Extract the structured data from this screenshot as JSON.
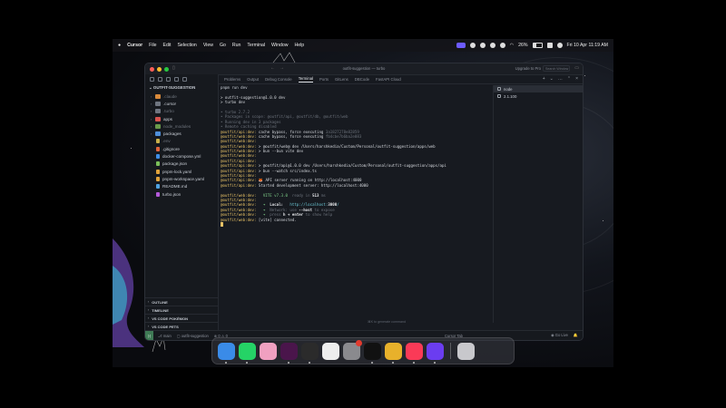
{
  "menubar": {
    "app": "Cursor",
    "menus": [
      "File",
      "Edit",
      "Selection",
      "View",
      "Go",
      "Run",
      "Terminal",
      "Window",
      "Help"
    ],
    "battery": "26%",
    "datetime": "Fri 10 Apr  11:19 AM"
  },
  "window": {
    "title": "outfit-suggestion — turbo",
    "upgrade": "Upgrade to Pro",
    "search_placeholder": "Search Window"
  },
  "sidebar": {
    "header": "OUTFIT-SUGGESTION",
    "items": [
      {
        "label": ".claude",
        "type": "folder",
        "color": "#d98a3b",
        "dim": true
      },
      {
        "label": ".cursor",
        "type": "folder",
        "color": "#6f7580",
        "dim": false
      },
      {
        "label": ".turbo",
        "type": "folder",
        "color": "#6f7580",
        "dim": true
      },
      {
        "label": "apps",
        "type": "folder",
        "color": "#d9534f",
        "dim": false
      },
      {
        "label": "node_modules",
        "type": "folder",
        "color": "#6a9a4a",
        "dim": true
      },
      {
        "label": "packages",
        "type": "folder",
        "color": "#4f8fd9",
        "dim": false
      },
      {
        "label": ".env",
        "type": "file",
        "color": "#c9b04a",
        "dim": true
      },
      {
        "label": ".gitignore",
        "type": "file",
        "color": "#e0633a",
        "dim": false
      },
      {
        "label": "docker-compose.yml",
        "type": "file",
        "color": "#3e8ee6",
        "dim": false
      },
      {
        "label": "package.json",
        "type": "file",
        "color": "#7bbf5a",
        "dim": false
      },
      {
        "label": "pnpm-lock.yaml",
        "type": "file",
        "color": "#e0a23a",
        "dim": false
      },
      {
        "label": "pnpm-workspace.yaml",
        "type": "file",
        "color": "#e0a23a",
        "dim": false
      },
      {
        "label": "README.md",
        "type": "file",
        "color": "#4fa3e0",
        "dim": false
      },
      {
        "label": "turbo.json",
        "type": "file",
        "color": "#b35ad9",
        "dim": false
      }
    ],
    "panels": [
      "OUTLINE",
      "TIMELINE",
      "VS CODE POKÉMON",
      "VS CODE PETS"
    ]
  },
  "panel_tabs": [
    {
      "label": "Problems",
      "active": false
    },
    {
      "label": "Output",
      "active": false
    },
    {
      "label": "Debug Console",
      "active": false
    },
    {
      "label": "Terminal",
      "active": true
    },
    {
      "label": "Ports",
      "active": false
    },
    {
      "label": "GitLens",
      "active": false
    },
    {
      "label": "DBCode",
      "active": false
    },
    {
      "label": "FastAPI Cloud",
      "active": false
    }
  ],
  "terminal_lines": [
    [
      {
        "t": "pnpm run dev",
        "c": "c-prompt"
      }
    ],
    [],
    [
      {
        "t": "> outfit-suggestion@1.0.0 dev",
        "c": ""
      }
    ],
    [
      {
        "t": "> turbo dev",
        "c": ""
      }
    ],
    [],
    [
      {
        "t": "• turbo 2.7.2",
        "c": "c-dim"
      }
    ],
    [
      {
        "t": "• Packages in scope: @outfit/api, @outfit/db, @outfit/web",
        "c": "c-dim"
      }
    ],
    [
      {
        "t": "• Running dev in 3 packages",
        "c": "c-dim"
      }
    ],
    [
      {
        "t": "• Remote caching disabled",
        "c": "c-dim"
      }
    ],
    [
      {
        "t": "@outfit/api:dev: ",
        "c": "c-y"
      },
      {
        "t": "cache bypass, force executing ",
        "c": ""
      },
      {
        "t": "3a1827278e82859",
        "c": "c-dim"
      }
    ],
    [
      {
        "t": "@outfit/web:dev: ",
        "c": "c-y"
      },
      {
        "t": "cache bypass, force executing ",
        "c": ""
      },
      {
        "t": "fb4cbe7b6ba2e083",
        "c": "c-dim"
      }
    ],
    [
      {
        "t": "@outfit/web:dev: ",
        "c": "c-y"
      }
    ],
    [
      {
        "t": "@outfit/web:dev: ",
        "c": "c-y"
      },
      {
        "t": "> @outfit/web@ dev /Users/harshkedia/Custom/Personal/outfit-suggestion/apps/web",
        "c": ""
      }
    ],
    [
      {
        "t": "@outfit/web:dev: ",
        "c": "c-y"
      },
      {
        "t": "> bun --bun vite dev",
        "c": ""
      }
    ],
    [
      {
        "t": "@outfit/web:dev: ",
        "c": "c-y"
      }
    ],
    [
      {
        "t": "@outfit/api:dev: ",
        "c": "c-y"
      }
    ],
    [
      {
        "t": "@outfit/api:dev: ",
        "c": "c-y"
      },
      {
        "t": "> @outfit/api@1.0.0 dev /Users/harshkedia/Custom/Personal/outfit-suggestion/apps/api",
        "c": ""
      }
    ],
    [
      {
        "t": "@outfit/api:dev: ",
        "c": "c-y"
      },
      {
        "t": "> bun --watch src/index.ts",
        "c": ""
      }
    ],
    [
      {
        "t": "@outfit/api:dev: ",
        "c": "c-y"
      }
    ],
    [
      {
        "t": "@outfit/api:dev: ",
        "c": "c-y"
      },
      {
        "t": "🦊 API server running on http://localhost:4000",
        "c": ""
      }
    ],
    [
      {
        "t": "@outfit/api:dev: ",
        "c": "c-y"
      },
      {
        "t": "Started development server: http://localhost:4000",
        "c": ""
      }
    ],
    [],
    [
      {
        "t": "@outfit/web:dev: ",
        "c": "c-y"
      },
      {
        "t": "  VITE ",
        "c": "c-g"
      },
      {
        "t": "v7.3.0  ",
        "c": "c-g"
      },
      {
        "t": "ready in ",
        "c": "c-dim"
      },
      {
        "t": "513",
        "c": "c-b"
      },
      {
        "t": " ms",
        "c": "c-dim"
      }
    ],
    [
      {
        "t": "@outfit/web:dev: ",
        "c": "c-y"
      }
    ],
    [
      {
        "t": "@outfit/web:dev: ",
        "c": "c-y"
      },
      {
        "t": "  ➜  ",
        "c": "c-g"
      },
      {
        "t": "Local:   ",
        "c": "c-b"
      },
      {
        "t": "http://localhost:",
        "c": "c-c"
      },
      {
        "t": "3000",
        "c": "c-b"
      },
      {
        "t": "/",
        "c": "c-c"
      }
    ],
    [
      {
        "t": "@outfit/web:dev: ",
        "c": "c-y"
      },
      {
        "t": "  ➜  ",
        "c": "c-g"
      },
      {
        "t": "Network: use ",
        "c": "c-dim"
      },
      {
        "t": "--host",
        "c": "c-b"
      },
      {
        "t": " to expose",
        "c": "c-dim"
      }
    ],
    [
      {
        "t": "@outfit/web:dev: ",
        "c": "c-y"
      },
      {
        "t": "  ➜  ",
        "c": "c-g"
      },
      {
        "t": "press ",
        "c": "c-dim"
      },
      {
        "t": "h + enter",
        "c": "c-b"
      },
      {
        "t": " to show help",
        "c": "c-dim"
      }
    ],
    [
      {
        "t": "@outfit/web:dev: ",
        "c": "c-y"
      },
      {
        "t": "[vite] connected.",
        "c": ""
      }
    ]
  ],
  "terminal_list": [
    {
      "label": "node",
      "active": true
    },
    {
      "label": "2.1.100",
      "active": false
    }
  ],
  "terminal_hint": "⌘K to generate command",
  "statusbar": {
    "branch": "main",
    "project": "outfit-suggestion",
    "problems": "⊗ 0  ⚠ 0",
    "center": "Cursor Tab",
    "golive": "Go Live"
  },
  "dock": [
    {
      "name": "finder-icon",
      "color": "#3a8be8",
      "running": true
    },
    {
      "name": "whatsapp-icon",
      "color": "#25d366",
      "running": true
    },
    {
      "name": "photos-icon",
      "color": "#f0a0c0",
      "running": false
    },
    {
      "name": "slack-icon",
      "color": "#4a154b",
      "running": true
    },
    {
      "name": "cursor-icon",
      "color": "#2b2b2b",
      "running": true
    },
    {
      "name": "notes-icon",
      "color": "#eeeeee",
      "running": false
    },
    {
      "name": "settings-icon",
      "color": "#8a8a8e",
      "running": false,
      "badge": true
    },
    {
      "name": "music-player-icon",
      "color": "#111111",
      "running": true
    },
    {
      "name": "chrome-icon",
      "color": "#e8b12b",
      "running": true
    },
    {
      "name": "apple-music-icon",
      "color": "#fa3a57",
      "running": true
    },
    {
      "name": "browser-ring-icon",
      "color": "#6b3df0",
      "running": true
    },
    {
      "name": "trash-icon",
      "color": "#c8c8cc",
      "running": false
    }
  ],
  "colors": {
    "accent": "#6d5bff",
    "remote": "#3f7a55",
    "prefix": "#e6c065"
  }
}
